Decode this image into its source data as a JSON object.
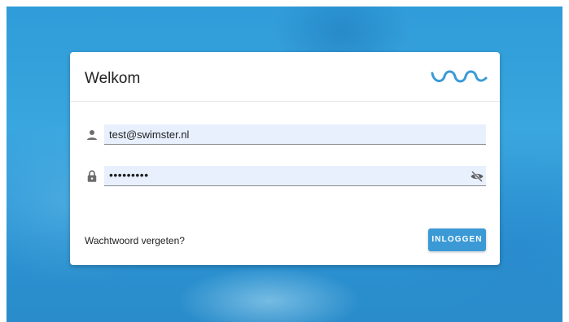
{
  "login": {
    "title": "Welkom",
    "logo_icon": "swimster-wave-logo",
    "email": {
      "value": "test@swimster.nl",
      "icon": "person-icon"
    },
    "password": {
      "masked_value": "•••••••••",
      "icon": "lock-icon",
      "toggle_icon": "eye-off-icon"
    },
    "forgot_link": "Wachtwoord vergeten?",
    "submit_label": "INLOGGEN"
  },
  "colors": {
    "accent": "#3b9ad6",
    "background": "#2f9bd8",
    "input_bg": "#e8f0fe"
  }
}
